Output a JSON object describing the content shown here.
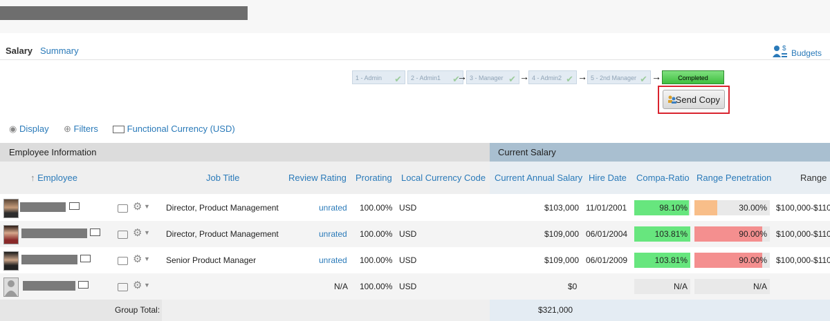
{
  "tabs": {
    "salary": "Salary",
    "summary": "Summary"
  },
  "budgets_label": "Budgets",
  "workflow": {
    "steps": [
      "1 - Admin",
      "2 - Admin1",
      "3 - Manager",
      "4 - Admin2",
      "5 - 2nd Manager"
    ],
    "completed_label": "Completed"
  },
  "send_copy_label": "Send Copy",
  "toolbar": {
    "display": "Display",
    "filters": "Filters",
    "currency": "Functional Currency (USD)"
  },
  "sections": {
    "employee_info": "Employee Information",
    "current_salary": "Current Salary"
  },
  "columns": {
    "employee": "Employee",
    "job_title": "Job Title",
    "review_rating": "Review Rating",
    "prorating": "Prorating",
    "local_currency_code": "Local Currency Code",
    "current_annual_salary": "Current Annual Salary",
    "hire_date": "Hire Date",
    "compa_ratio": "Compa-Ratio",
    "range_penetration": "Range Penetration",
    "range": "Range"
  },
  "rows": [
    {
      "job_title": "Director, Product Management",
      "review_rating": "unrated",
      "prorating": "100.00%",
      "currency": "USD",
      "salary": "$103,000",
      "hire_date": "11/01/2001",
      "compa_ratio": "98.10%",
      "compa_ratio_value": 0.981,
      "range_penetration": "30.00%",
      "range_penetration_value": 0.3,
      "range": "$100,000-$110"
    },
    {
      "job_title": "Director, Product Management",
      "review_rating": "unrated",
      "prorating": "100.00%",
      "currency": "USD",
      "salary": "$109,000",
      "hire_date": "06/01/2004",
      "compa_ratio": "103.81%",
      "compa_ratio_value": 1.0381,
      "range_penetration": "90.00%",
      "range_penetration_value": 0.9,
      "range": "$100,000-$110"
    },
    {
      "job_title": "Senior Product Manager",
      "review_rating": "unrated",
      "prorating": "100.00%",
      "currency": "USD",
      "salary": "$109,000",
      "hire_date": "06/01/2009",
      "compa_ratio": "103.81%",
      "compa_ratio_value": 1.0381,
      "range_penetration": "90.00%",
      "range_penetration_value": 0.9,
      "range": "$100,000-$110"
    },
    {
      "job_title": "",
      "review_rating": "N/A",
      "prorating": "100.00%",
      "currency": "USD",
      "salary": "$0",
      "hire_date": "",
      "compa_ratio": "N/A",
      "range_penetration": "N/A",
      "range": ""
    }
  ],
  "group_total": {
    "label": "Group Total:",
    "salary": "$321,000"
  },
  "colors": {
    "link": "#2a7ab9",
    "green": "#67e67e",
    "orange": "#f8be89",
    "red": "#f48f8f",
    "highlight": "#d9232e"
  }
}
